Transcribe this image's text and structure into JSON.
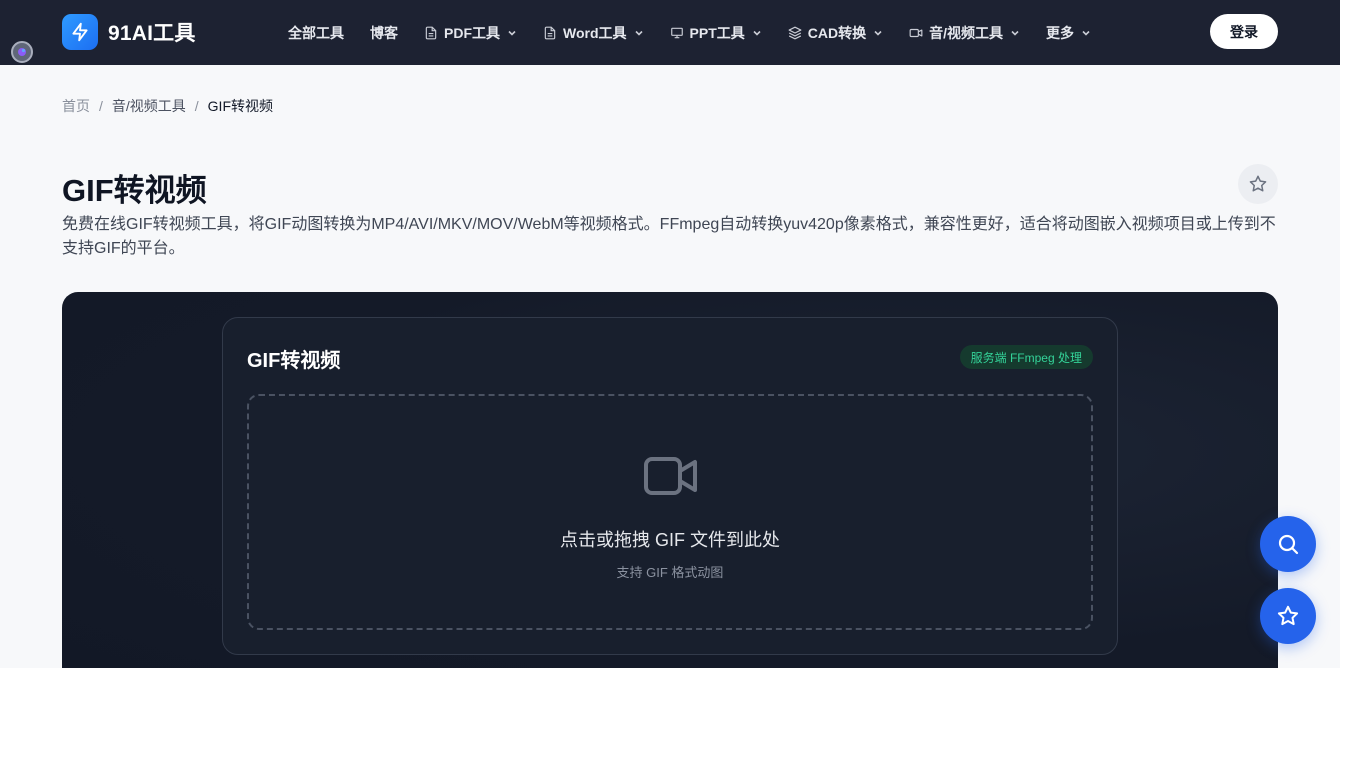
{
  "header": {
    "logo_text": "91AI工具",
    "nav": [
      {
        "label": "全部工具",
        "icon": "",
        "dropdown": false
      },
      {
        "label": "博客",
        "icon": "",
        "dropdown": false
      },
      {
        "label": "PDF工具",
        "icon": "file-icon",
        "dropdown": true
      },
      {
        "label": "Word工具",
        "icon": "file-icon",
        "dropdown": true
      },
      {
        "label": "PPT工具",
        "icon": "presentation-icon",
        "dropdown": true
      },
      {
        "label": "CAD转换",
        "icon": "layers-icon",
        "dropdown": true
      },
      {
        "label": "音/视频工具",
        "icon": "video-icon",
        "dropdown": true
      },
      {
        "label": "更多",
        "icon": "",
        "dropdown": true
      }
    ],
    "login_label": "登录"
  },
  "breadcrumb": {
    "home": "首页",
    "category": "音/视频工具",
    "current": "GIF转视频",
    "separator": "/"
  },
  "page": {
    "title": "GIF转视频",
    "description": "免费在线GIF转视频工具，将GIF动图转换为MP4/AVI/MKV/MOV/WebM等视频格式。FFmpeg自动转换yuv420p像素格式，兼容性更好，适合将动图嵌入视频项目或上传到不支持GIF的平台。"
  },
  "tool": {
    "title": "GIF转视频",
    "badge": "服务端 FFmpeg 处理",
    "dropzone_main": "点击或拖拽 GIF 文件到此处",
    "dropzone_sub": "支持 GIF 格式动图"
  },
  "colors": {
    "nav_bg": "#1d2232",
    "accent": "#2563eb",
    "badge_text": "#34d399"
  }
}
